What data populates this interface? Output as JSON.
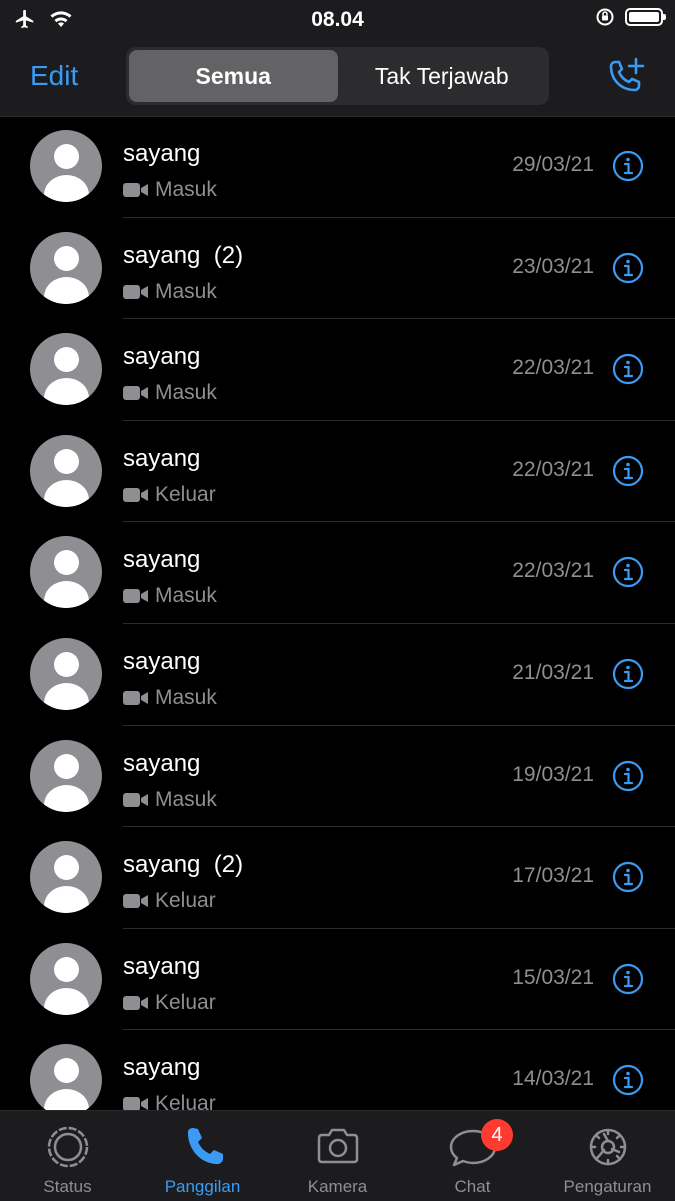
{
  "status": {
    "time": "08.04"
  },
  "header": {
    "edit_label": "Edit",
    "tabs": [
      {
        "label": "Semua",
        "active": true
      },
      {
        "label": "Tak Terjawab",
        "active": false
      }
    ]
  },
  "calls": [
    {
      "name": "sayang",
      "type": "Masuk",
      "date": "29/03/21"
    },
    {
      "name": "sayang  (2)",
      "type": "Masuk",
      "date": "23/03/21"
    },
    {
      "name": "sayang",
      "type": "Masuk",
      "date": "22/03/21"
    },
    {
      "name": "sayang",
      "type": "Keluar",
      "date": "22/03/21"
    },
    {
      "name": "sayang",
      "type": "Masuk",
      "date": "22/03/21"
    },
    {
      "name": "sayang",
      "type": "Masuk",
      "date": "21/03/21"
    },
    {
      "name": "sayang",
      "type": "Masuk",
      "date": "19/03/21"
    },
    {
      "name": "sayang  (2)",
      "type": "Keluar",
      "date": "17/03/21"
    },
    {
      "name": "sayang",
      "type": "Keluar",
      "date": "15/03/21"
    },
    {
      "name": "sayang",
      "type": "Keluar",
      "date": "14/03/21"
    }
  ],
  "tabbar": {
    "items": [
      {
        "label": "Status",
        "icon": "status-icon",
        "active": false
      },
      {
        "label": "Panggilan",
        "icon": "phone-icon",
        "active": true
      },
      {
        "label": "Kamera",
        "icon": "camera-icon",
        "active": false
      },
      {
        "label": "Chat",
        "icon": "chat-icon",
        "active": false,
        "badge": "4"
      },
      {
        "label": "Pengaturan",
        "icon": "gear-icon",
        "active": false
      }
    ]
  },
  "colors": {
    "accent": "#3b9bf4",
    "badge": "#ff3b30",
    "secondary_text": "#8e8e93"
  }
}
